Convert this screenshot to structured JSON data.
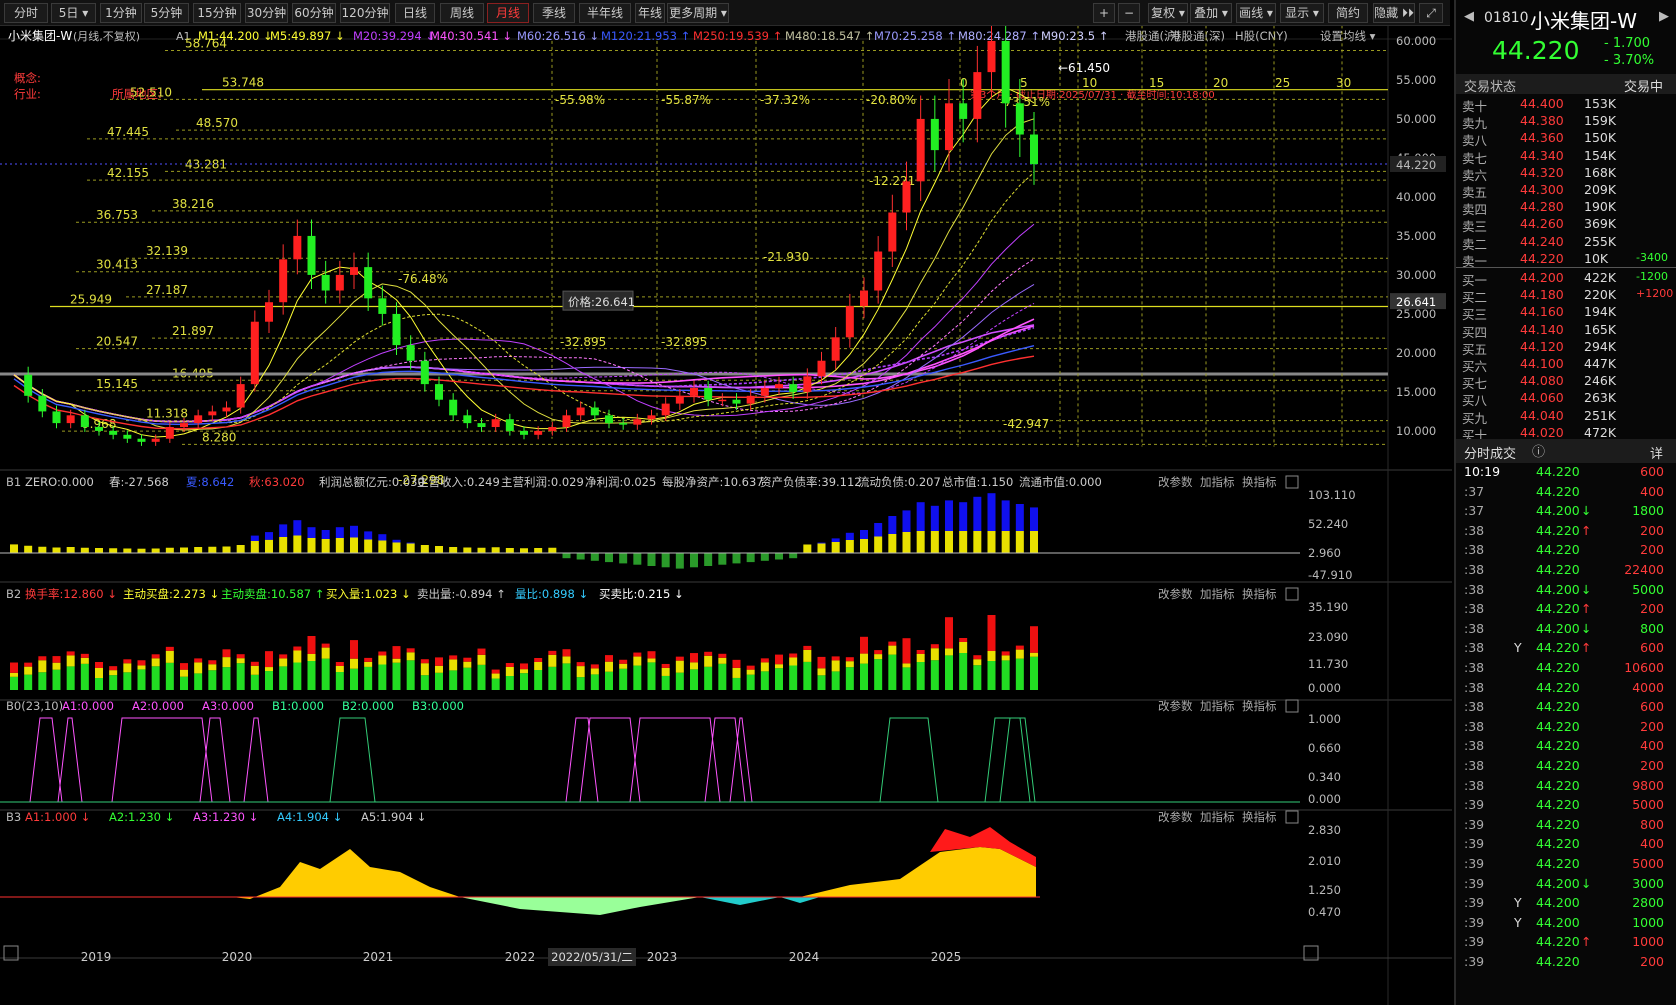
{
  "toolbar": {
    "periods": [
      "分时",
      "5日",
      "1分钟",
      "5分钟",
      "15分钟",
      "30分钟",
      "60分钟",
      "120分钟",
      "日线",
      "周线",
      "月线",
      "季线",
      "半年线",
      "年线",
      "更多周期"
    ],
    "active": "月线",
    "right": [
      "+",
      "−",
      "复权",
      "叠加",
      "画线",
      "显示",
      "简约",
      "隐藏",
      "⤢"
    ]
  },
  "main": {
    "title": "小米集团-W",
    "subtitle": "(月线,不复权)",
    "ind_prefix": "A1",
    "ma": [
      {
        "t": "M1:44.200",
        "c": "#ffff33"
      },
      {
        "t": "M5:49.897",
        "c": "#ffff33"
      },
      {
        "t": "M20:39.294",
        "c": "#c040ff"
      },
      {
        "t": "M40:30.541",
        "c": "#ff55ff"
      },
      {
        "t": "M60:26.516",
        "c": "#9a9aff"
      },
      {
        "t": "M120:21.953",
        "c": "#3a5aff"
      },
      {
        "t": "M250:19.539",
        "c": "#ff3030"
      },
      {
        "t": "M480:18.547",
        "c": "#c0c0a0"
      },
      {
        "t": "M70:25.258",
        "c": "#9a9aff"
      },
      {
        "t": "M80:24.287",
        "c": "#b0b0ff"
      },
      {
        "t": "M90:23.5",
        "c": "#d0d0ff"
      }
    ],
    "links": [
      "港股通(沪)",
      "港股通(深)",
      "H股(CNY)",
      "设置均线"
    ],
    "concept_label": "概念:",
    "industry_label": "行业:",
    "region_label": "所属地区:",
    "price_labels": [
      "60.000",
      "55.000",
      "50.000",
      "45.000",
      "40.000",
      "35.000",
      "30.000",
      "25.000",
      "20.000",
      "15.000",
      "10.000"
    ],
    "current_price": "44.220",
    "crosshair_price": "26.641",
    "tooltip": "价格:26.641",
    "fib_levels": [
      "58.764",
      "53.748",
      "52.510",
      "48.570",
      "47.445",
      "43.281",
      "42.155",
      "38.216",
      "36.753",
      "32.139",
      "30.413",
      "27.187",
      "25.949",
      "21.897",
      "20.547",
      "16.495",
      "15.145",
      "11.318",
      "9.968",
      "8.280"
    ],
    "pct_labels": [
      "-55.98%",
      "-55.87%",
      "-37.32%",
      "-20.80%",
      "-73.51%",
      "-76.48%"
    ],
    "misc_labels": [
      "-12.221",
      "-21.930",
      "-32.895",
      "-32.895",
      "-27.298",
      "-42.947",
      "←61.450"
    ],
    "counts": [
      "0",
      "5",
      "10",
      "15",
      "20",
      "25",
      "30"
    ],
    "red_note": "第3个月 · 截止日期:2025/07/31 · 截至时间:10:18:00"
  },
  "b1": {
    "prefix": "B1",
    "labels": [
      {
        "t": "ZERO:0.000",
        "c": "#ccc"
      },
      {
        "t": "春:-27.568",
        "c": "#ccc"
      },
      {
        "t": "夏:8.642",
        "c": "#3a5aff"
      },
      {
        "t": "秋:63.020",
        "c": "#ff3b3b"
      },
      {
        "t": "利润总额亿元:0.030",
        "c": "#ccc"
      },
      {
        "t": "主营收入:0.249",
        "c": "#ccc"
      },
      {
        "t": "主营利润:0.029",
        "c": "#ccc"
      },
      {
        "t": "净利润:0.025",
        "c": "#ccc"
      },
      {
        "t": "每股净资产:10.637",
        "c": "#ccc"
      },
      {
        "t": "资产负债率:39.112",
        "c": "#ccc"
      },
      {
        "t": "流动负债:0.207",
        "c": "#ccc"
      },
      {
        "t": "总市值:1.150",
        "c": "#ccc"
      },
      {
        "t": "流通市值:0.000",
        "c": "#ccc"
      }
    ],
    "axis": [
      "103.110",
      "52.240",
      "2.960",
      "-47.910"
    ]
  },
  "b2": {
    "prefix": "B2",
    "labels": [
      {
        "t": "换手率:12.860 ↓",
        "c": "#ff3b3b"
      },
      {
        "t": "主动买盘:2.273 ↓",
        "c": "#ffff33"
      },
      {
        "t": "主动卖盘:10.587 ↑",
        "c": "#33ff33"
      },
      {
        "t": "买入量:1.023 ↓",
        "c": "#ffff33"
      },
      {
        "t": "卖出量:-0.894 ↑",
        "c": "#ccc"
      },
      {
        "t": "量比:0.898 ↓",
        "c": "#33ccff"
      },
      {
        "t": "买卖比:0.215 ↓",
        "c": "#fff"
      }
    ],
    "axis": [
      "35.190",
      "23.090",
      "11.730",
      "0.000"
    ]
  },
  "b0": {
    "prefix": "B0(23,10)",
    "labels": [
      {
        "t": "A1:0.000",
        "c": "#ff55ff"
      },
      {
        "t": "A2:0.000",
        "c": "#ff55ff"
      },
      {
        "t": "A3:0.000",
        "c": "#ff55ff"
      },
      {
        "t": "B1:0.000",
        "c": "#33ff99"
      },
      {
        "t": "B2:0.000",
        "c": "#33ff99"
      },
      {
        "t": "B3:0.000",
        "c": "#33ff99"
      }
    ],
    "axis": [
      "1.000",
      "0.660",
      "0.340",
      "0.000"
    ]
  },
  "b3": {
    "prefix": "B3",
    "labels": [
      {
        "t": "A1:1.000 ↓",
        "c": "#ff3b3b"
      },
      {
        "t": "A2:1.230 ↓",
        "c": "#33ff33"
      },
      {
        "t": "A3:1.230 ↓",
        "c": "#ff55ff"
      },
      {
        "t": "A4:1.904 ↓",
        "c": "#33ccff"
      },
      {
        "t": "A5:1.904 ↓",
        "c": "#ccc"
      }
    ],
    "axis": [
      "2.830",
      "2.010",
      "1.250",
      "0.470"
    ]
  },
  "panel_buttons": [
    "改参数",
    "加指标",
    "换指标"
  ],
  "xaxis": {
    "years": [
      "2019",
      "2020",
      "2021",
      "2022",
      "2023",
      "2024",
      "2025"
    ],
    "cursor_date": "2022/05/31/二"
  },
  "right": {
    "code": "01810",
    "name": "小米集团-W",
    "price": "44.220",
    "change": "- 1.700",
    "change_pct": "- 3.70%",
    "trade_status": "交易状态",
    "exchange": "交易中",
    "asks": [
      {
        "l": "卖十",
        "p": "44.400",
        "v": "153K",
        "d": ""
      },
      {
        "l": "卖九",
        "p": "44.380",
        "v": "159K",
        "d": ""
      },
      {
        "l": "卖八",
        "p": "44.360",
        "v": "150K",
        "d": ""
      },
      {
        "l": "卖七",
        "p": "44.340",
        "v": "154K",
        "d": ""
      },
      {
        "l": "卖六",
        "p": "44.320",
        "v": "168K",
        "d": ""
      },
      {
        "l": "卖五",
        "p": "44.300",
        "v": "209K",
        "d": ""
      },
      {
        "l": "卖四",
        "p": "44.280",
        "v": "190K",
        "d": ""
      },
      {
        "l": "卖三",
        "p": "44.260",
        "v": "369K",
        "d": ""
      },
      {
        "l": "卖二",
        "p": "44.240",
        "v": "255K",
        "d": ""
      },
      {
        "l": "卖一",
        "p": "44.220",
        "v": "10K",
        "d": "-3400"
      }
    ],
    "bids": [
      {
        "l": "买一",
        "p": "44.200",
        "v": "422K",
        "d": "-1200"
      },
      {
        "l": "买二",
        "p": "44.180",
        "v": "220K",
        "d": "+1200"
      },
      {
        "l": "买三",
        "p": "44.160",
        "v": "194K",
        "d": ""
      },
      {
        "l": "买四",
        "p": "44.140",
        "v": "165K",
        "d": ""
      },
      {
        "l": "买五",
        "p": "44.120",
        "v": "294K",
        "d": ""
      },
      {
        "l": "买六",
        "p": "44.100",
        "v": "447K",
        "d": ""
      },
      {
        "l": "买七",
        "p": "44.080",
        "v": "246K",
        "d": ""
      },
      {
        "l": "买八",
        "p": "44.060",
        "v": "263K",
        "d": ""
      },
      {
        "l": "买九",
        "p": "44.040",
        "v": "251K",
        "d": ""
      },
      {
        "l": "买十",
        "p": "44.020",
        "v": "472K",
        "d": ""
      }
    ],
    "trades_title": "分时成交",
    "detail": "详",
    "trades": [
      {
        "t": "10:19",
        "f": "",
        "p": "44.220",
        "v": "600",
        "dir": "",
        "vc": "#ff3b3b",
        "tc": "#fff"
      },
      {
        "t": ":37",
        "f": "",
        "p": "44.220",
        "v": "400",
        "dir": "",
        "vc": "#ff3b3b",
        "tc": "#aaa"
      },
      {
        "t": ":37",
        "f": "",
        "p": "44.200",
        "v": "1800",
        "dir": "↓",
        "vc": "#33ff33",
        "tc": "#aaa"
      },
      {
        "t": ":38",
        "f": "",
        "p": "44.220",
        "v": "200",
        "dir": "↑",
        "vc": "#ff3b3b",
        "tc": "#aaa"
      },
      {
        "t": ":38",
        "f": "",
        "p": "44.220",
        "v": "200",
        "dir": "",
        "vc": "#ff3b3b",
        "tc": "#aaa"
      },
      {
        "t": ":38",
        "f": "",
        "p": "44.220",
        "v": "22400",
        "dir": "",
        "vc": "#ff3b3b",
        "tc": "#aaa"
      },
      {
        "t": ":38",
        "f": "",
        "p": "44.200",
        "v": "5000",
        "dir": "↓",
        "vc": "#33ff33",
        "tc": "#aaa"
      },
      {
        "t": ":38",
        "f": "",
        "p": "44.220",
        "v": "200",
        "dir": "↑",
        "vc": "#ff3b3b",
        "tc": "#aaa"
      },
      {
        "t": ":38",
        "f": "",
        "p": "44.200",
        "v": "800",
        "dir": "↓",
        "vc": "#33ff33",
        "tc": "#aaa"
      },
      {
        "t": ":38",
        "f": "Y",
        "p": "44.220",
        "v": "600",
        "dir": "↑",
        "vc": "#ff3b3b",
        "tc": "#aaa"
      },
      {
        "t": ":38",
        "f": "",
        "p": "44.220",
        "v": "10600",
        "dir": "",
        "vc": "#ff3b3b",
        "tc": "#aaa"
      },
      {
        "t": ":38",
        "f": "",
        "p": "44.220",
        "v": "4000",
        "dir": "",
        "vc": "#ff3b3b",
        "tc": "#aaa"
      },
      {
        "t": ":38",
        "f": "",
        "p": "44.220",
        "v": "600",
        "dir": "",
        "vc": "#ff3b3b",
        "tc": "#aaa"
      },
      {
        "t": ":38",
        "f": "",
        "p": "44.220",
        "v": "200",
        "dir": "",
        "vc": "#ff3b3b",
        "tc": "#aaa"
      },
      {
        "t": ":38",
        "f": "",
        "p": "44.220",
        "v": "400",
        "dir": "",
        "vc": "#ff3b3b",
        "tc": "#aaa"
      },
      {
        "t": ":38",
        "f": "",
        "p": "44.220",
        "v": "200",
        "dir": "",
        "vc": "#ff3b3b",
        "tc": "#aaa"
      },
      {
        "t": ":38",
        "f": "",
        "p": "44.220",
        "v": "9800",
        "dir": "",
        "vc": "#ff3b3b",
        "tc": "#aaa"
      },
      {
        "t": ":39",
        "f": "",
        "p": "44.220",
        "v": "5000",
        "dir": "",
        "vc": "#ff3b3b",
        "tc": "#aaa"
      },
      {
        "t": ":39",
        "f": "",
        "p": "44.220",
        "v": "800",
        "dir": "",
        "vc": "#ff3b3b",
        "tc": "#aaa"
      },
      {
        "t": ":39",
        "f": "",
        "p": "44.220",
        "v": "400",
        "dir": "",
        "vc": "#ff3b3b",
        "tc": "#aaa"
      },
      {
        "t": ":39",
        "f": "",
        "p": "44.220",
        "v": "5000",
        "dir": "",
        "vc": "#ff3b3b",
        "tc": "#aaa"
      },
      {
        "t": ":39",
        "f": "",
        "p": "44.200",
        "v": "3000",
        "dir": "↓",
        "vc": "#33ff33",
        "tc": "#aaa"
      },
      {
        "t": ":39",
        "f": "Y",
        "p": "44.200",
        "v": "2800",
        "dir": "",
        "vc": "#33ff33",
        "tc": "#aaa"
      },
      {
        "t": ":39",
        "f": "Y",
        "p": "44.200",
        "v": "1000",
        "dir": "",
        "vc": "#33ff33",
        "tc": "#aaa"
      },
      {
        "t": ":39",
        "f": "",
        "p": "44.220",
        "v": "1000",
        "dir": "↑",
        "vc": "#ff3b3b",
        "tc": "#aaa"
      },
      {
        "t": ":39",
        "f": "",
        "p": "44.220",
        "v": "200",
        "dir": "",
        "vc": "#ff3b3b",
        "tc": "#aaa"
      }
    ]
  }
}
